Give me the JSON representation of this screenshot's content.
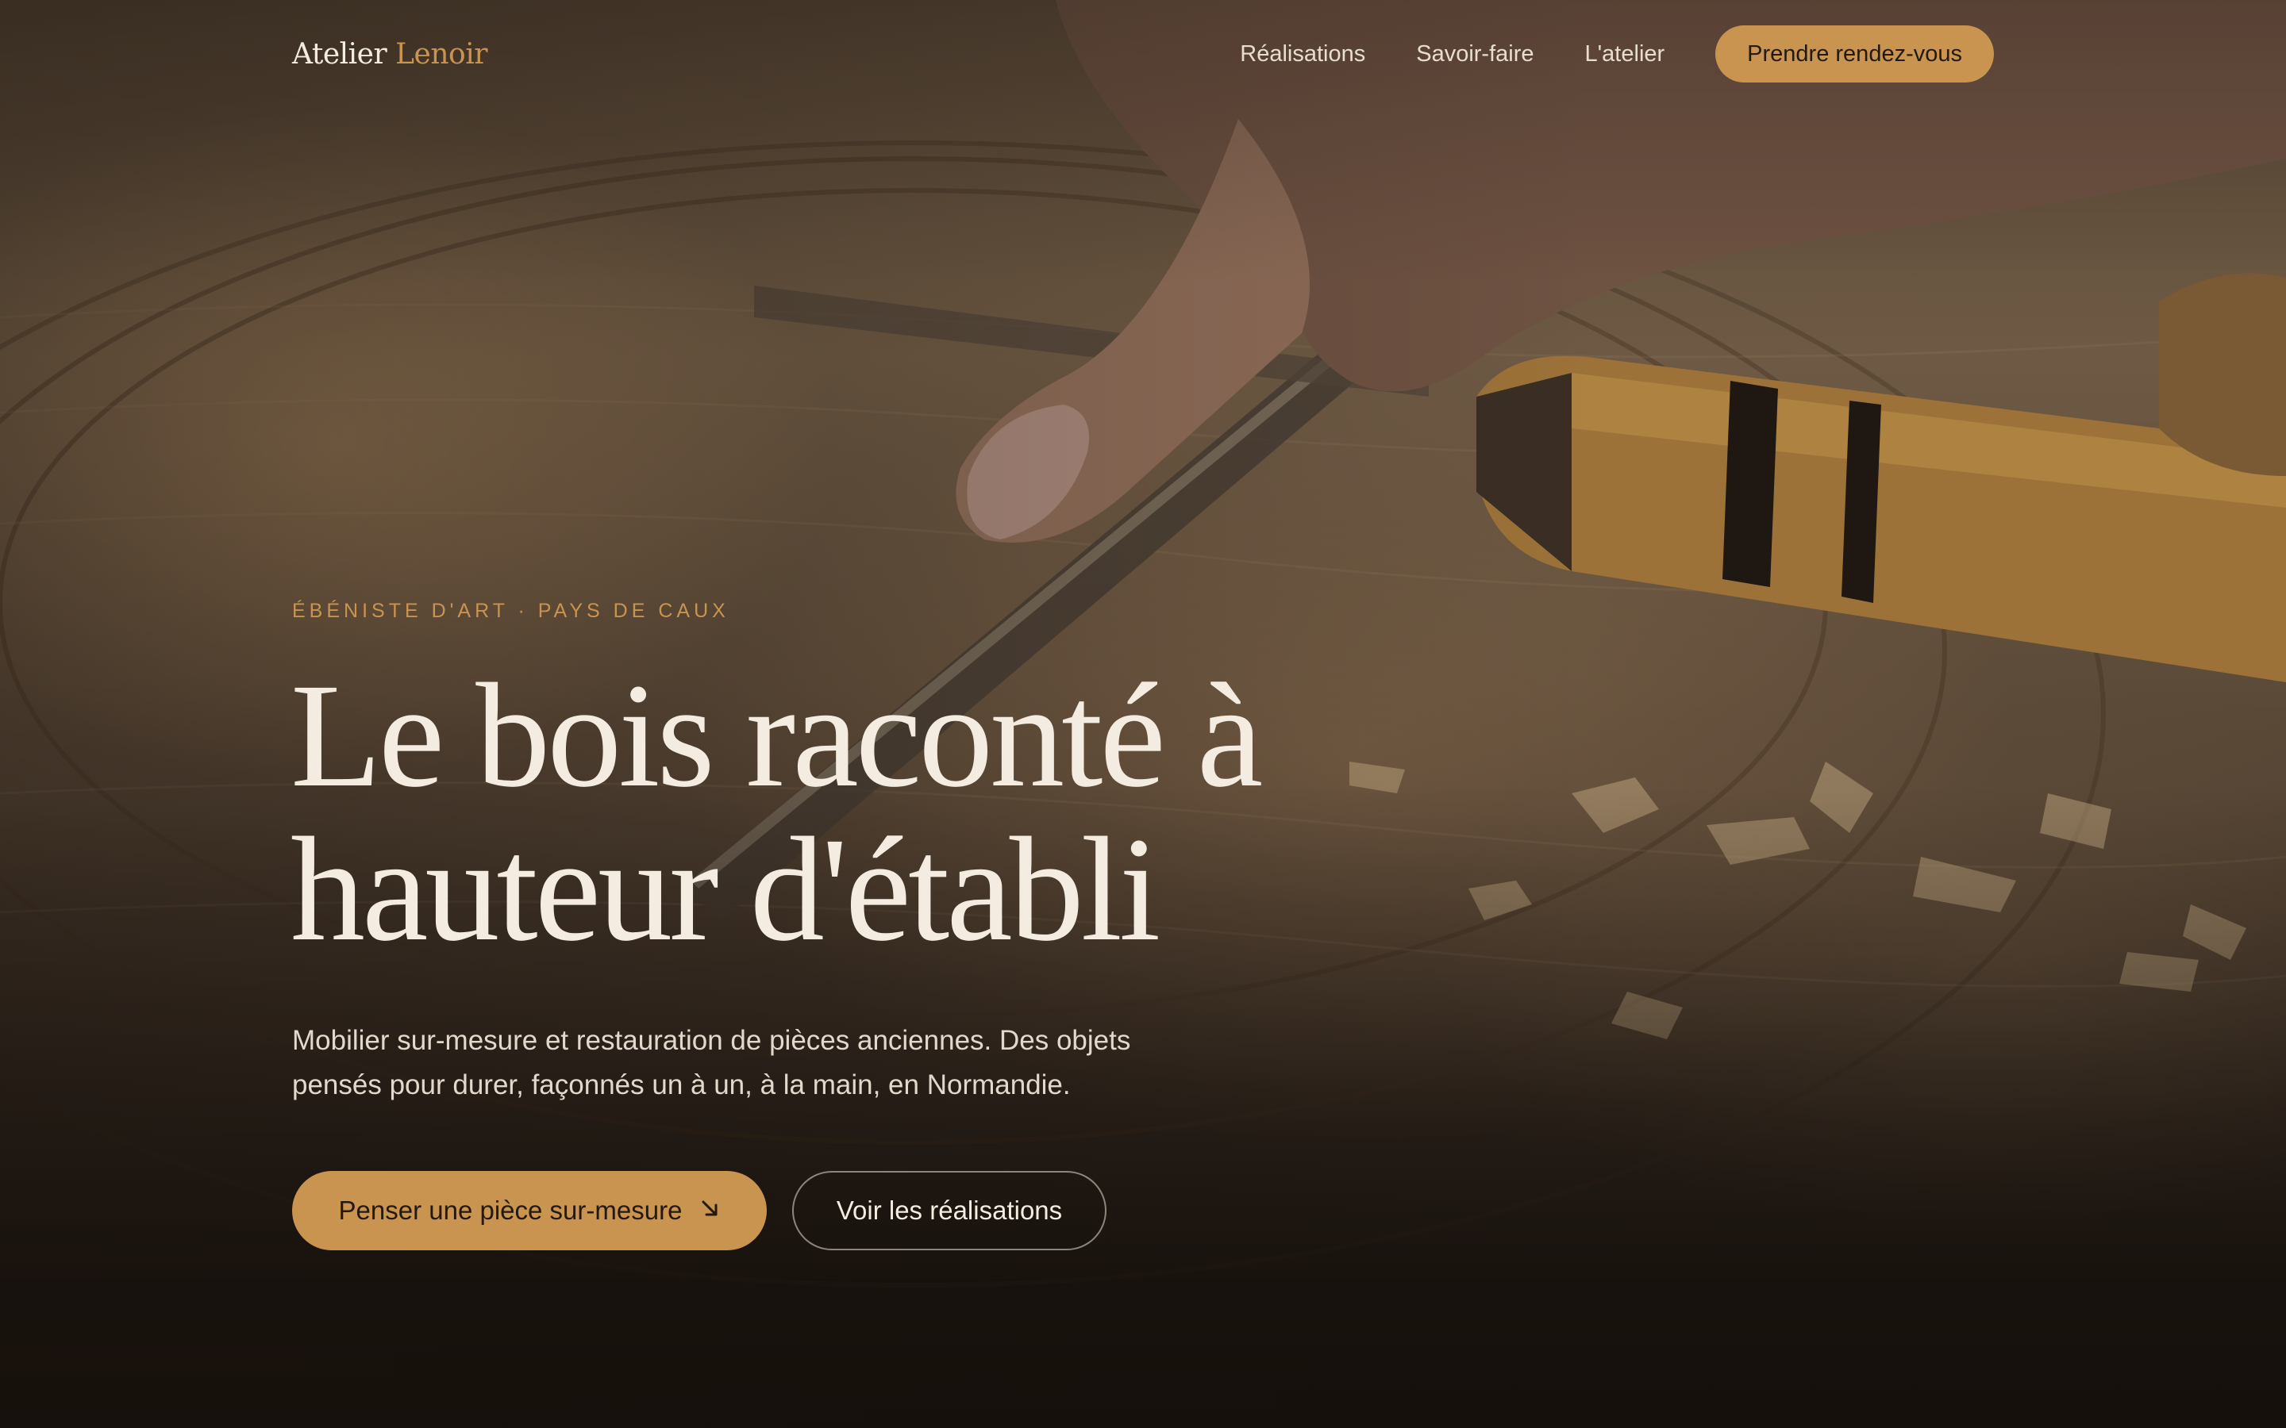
{
  "nav": {
    "logo_primary": "Atelier",
    "logo_accent": "Lenoir",
    "links": [
      "Réalisations",
      "Savoir-faire",
      "L'atelier"
    ],
    "cta": "Prendre rendez-vous"
  },
  "hero": {
    "eyebrow": "ÉBÉNISTE D'ART · PAYS DE CAUX",
    "headline_line1": "Le bois raconté à",
    "headline_line2": "hauteur d'établi",
    "lead_line1": "Mobilier sur-mesure et restauration de pièces anciennes. Des objets",
    "lead_line2": "pensés pour durer, façonnés un à un, à la main, en Normandie.",
    "primary_cta": "Penser une pièce sur-mesure",
    "primary_cta_icon": "arrow-down-right-icon",
    "secondary_cta": "Voir les réalisations"
  },
  "colors": {
    "accent": "#c9944f",
    "text_light": "#f4ece0",
    "background_dark": "#1d1611"
  }
}
